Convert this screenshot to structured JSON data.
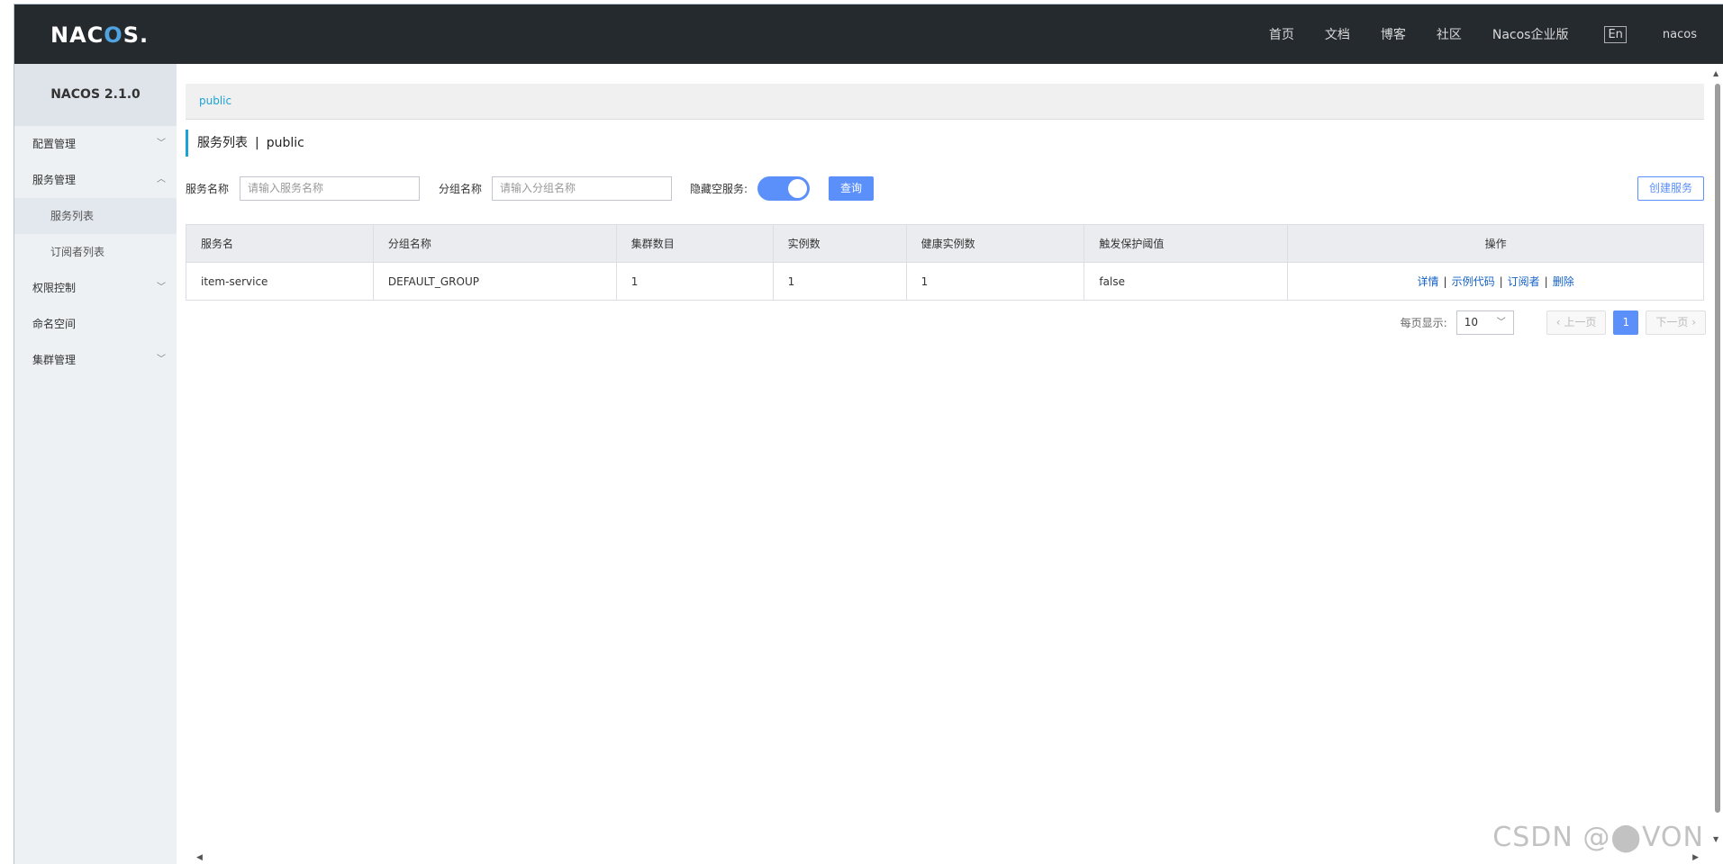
{
  "header": {
    "logo_main": "NAC",
    "logo_o": "O",
    "logo_tail": "S.",
    "nav": [
      "首页",
      "文档",
      "博客",
      "社区",
      "Nacos企业版"
    ],
    "lang": "En",
    "user": "nacos"
  },
  "sidebar": {
    "version": "NACOS 2.1.0",
    "items": [
      {
        "label": "配置管理",
        "chevron": "chevron-down-icon"
      },
      {
        "label": "服务管理",
        "chevron": "chevron-up-icon"
      },
      {
        "label": "服务列表"
      },
      {
        "label": "订阅者列表"
      },
      {
        "label": "权限控制",
        "chevron": "chevron-down-icon"
      },
      {
        "label": "命名空间"
      },
      {
        "label": "集群管理",
        "chevron": "chevron-down-icon"
      }
    ]
  },
  "breadcrumb": {
    "namespace": "public"
  },
  "page": {
    "title": "服务列表",
    "separator": "|",
    "namespace": "public"
  },
  "filters": {
    "service_name_label": "服务名称",
    "service_name_placeholder": "请输入服务名称",
    "group_name_label": "分组名称",
    "group_name_placeholder": "请输入分组名称",
    "hide_empty_label": "隐藏空服务:",
    "hide_empty_on": true,
    "query_button": "查询",
    "create_button": "创建服务"
  },
  "table": {
    "columns": [
      "服务名",
      "分组名称",
      "集群数目",
      "实例数",
      "健康实例数",
      "触发保护阈值",
      "操作"
    ],
    "rows": [
      {
        "service": "item-service",
        "group": "DEFAULT_GROUP",
        "clusters": "1",
        "instances": "1",
        "healthy": "1",
        "threshold": "false",
        "ops": [
          "详情",
          "示例代码",
          "订阅者",
          "删除"
        ]
      }
    ]
  },
  "pagination": {
    "page_size_label": "每页显示:",
    "page_size": "10",
    "prev": "上一页",
    "next": "下一页",
    "current": "1"
  },
  "watermark": "CSDN @⬤VON"
}
